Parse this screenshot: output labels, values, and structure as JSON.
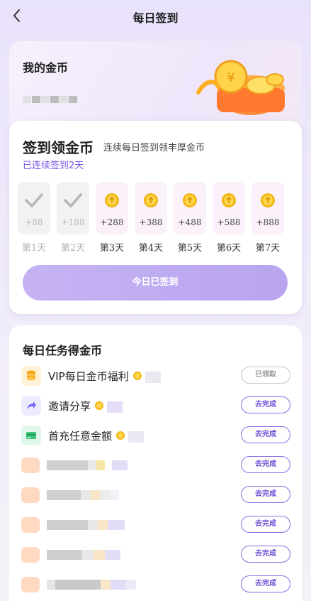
{
  "header": {
    "title": "每日签到"
  },
  "coins": {
    "title": "我的金币"
  },
  "signin": {
    "title": "签到领金币",
    "subtitle": "连续每日签到领丰厚金币",
    "streak": "已连续签到2天",
    "days": [
      {
        "amount": "+88",
        "label": "第1天",
        "state": "done"
      },
      {
        "amount": "+188",
        "label": "第2天",
        "state": "done"
      },
      {
        "amount": "+288",
        "label": "第3天",
        "state": "todo"
      },
      {
        "amount": "+388",
        "label": "第4天",
        "state": "todo"
      },
      {
        "amount": "+488",
        "label": "第5天",
        "state": "todo"
      },
      {
        "amount": "+588",
        "label": "第6天",
        "state": "todo"
      },
      {
        "amount": "+888",
        "label": "第7天",
        "state": "todo"
      }
    ],
    "button_label": "今日已签到"
  },
  "tasks": {
    "title": "每日任务得金币",
    "items": [
      {
        "name": "VIP每日金币福利",
        "button": "已领取",
        "icon": "coins-stack-icon"
      },
      {
        "name": "邀请分享",
        "button": "去完成",
        "icon": "share-arrow-icon"
      },
      {
        "name": "首充任意金额",
        "button": "去完成",
        "icon": "card-icon"
      },
      {
        "name": "",
        "button": "去完成",
        "icon": "blurred-icon"
      },
      {
        "name": "",
        "button": "去完成",
        "icon": "blurred-icon"
      },
      {
        "name": "",
        "button": "去完成",
        "icon": "blurred-icon"
      },
      {
        "name": "",
        "button": "去完成",
        "icon": "blurred-icon"
      },
      {
        "name": "",
        "button": "去完成",
        "icon": "blurred-icon"
      }
    ]
  },
  "colors": {
    "accent": "#7a55e8",
    "button_gradient_start": "#c6b3f3",
    "button_gradient_end": "#b9a4ef",
    "coin": "#f2b615"
  }
}
